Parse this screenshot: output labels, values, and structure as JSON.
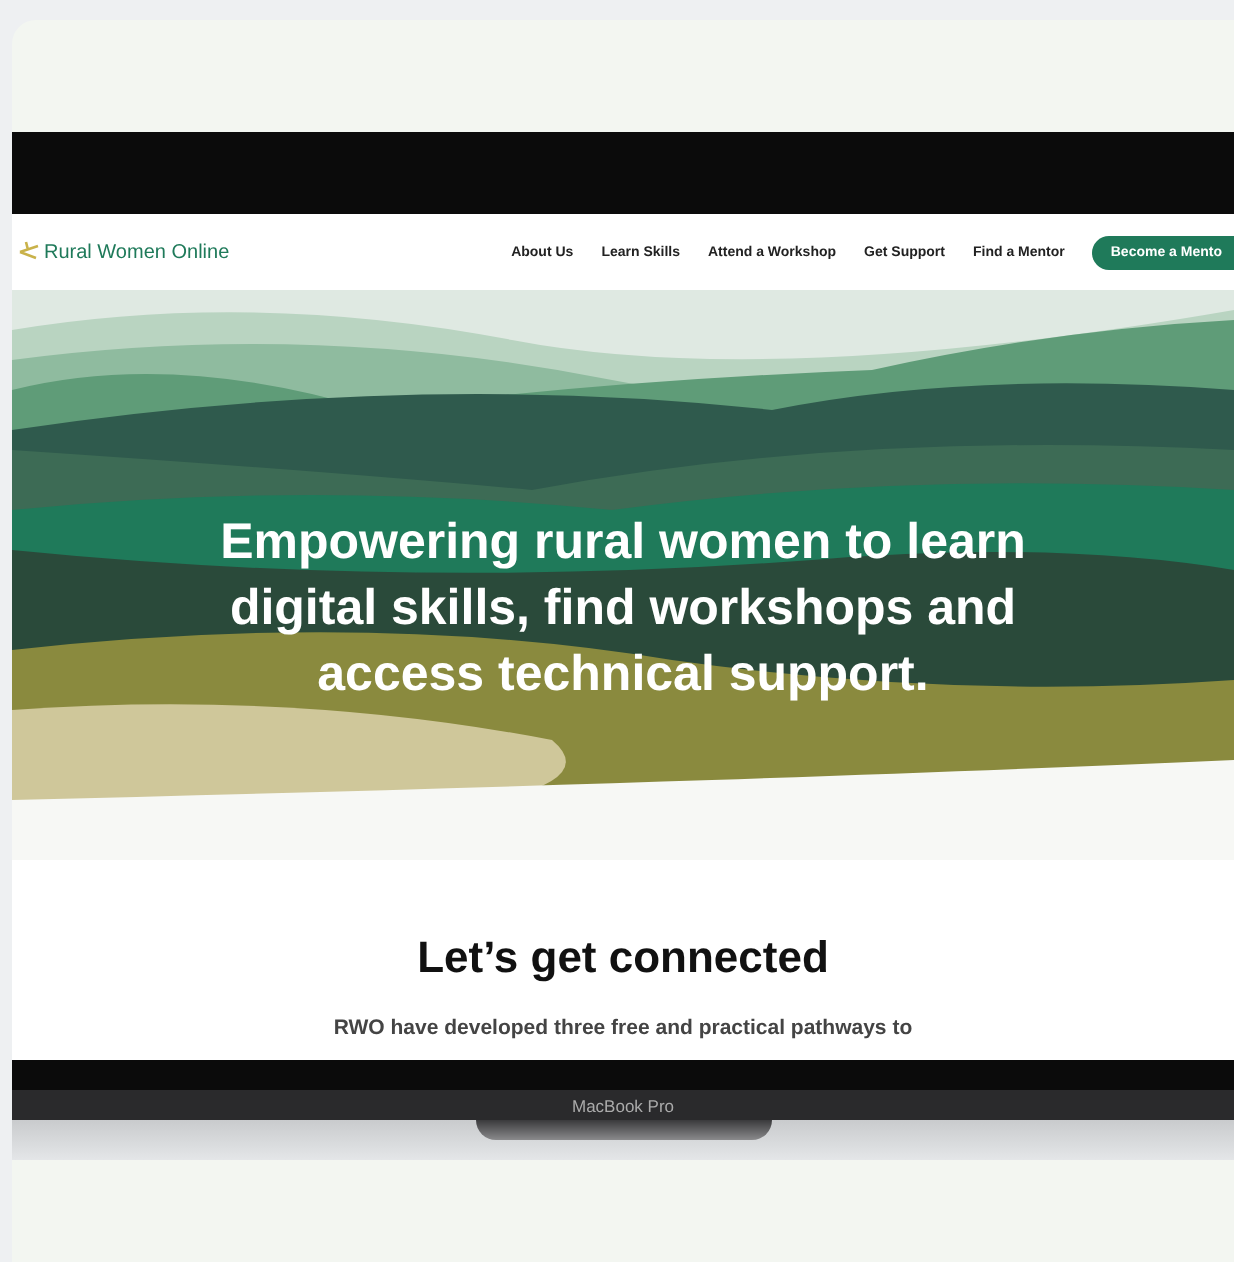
{
  "site": {
    "logo_text": "Rural Women Online",
    "nav": [
      {
        "label": "About Us"
      },
      {
        "label": "Learn Skills"
      },
      {
        "label": "Attend a Workshop"
      },
      {
        "label": "Get Support"
      },
      {
        "label": "Find a Mentor"
      }
    ],
    "cta": "Become a Mento"
  },
  "hero": {
    "heading": "Empowering rural women to learn digital skills, find workshops and access technical support."
  },
  "section": {
    "heading": "Let’s get connected",
    "text": "RWO have developed three free and practical pathways to"
  },
  "device": {
    "label": "MacBook Pro"
  }
}
